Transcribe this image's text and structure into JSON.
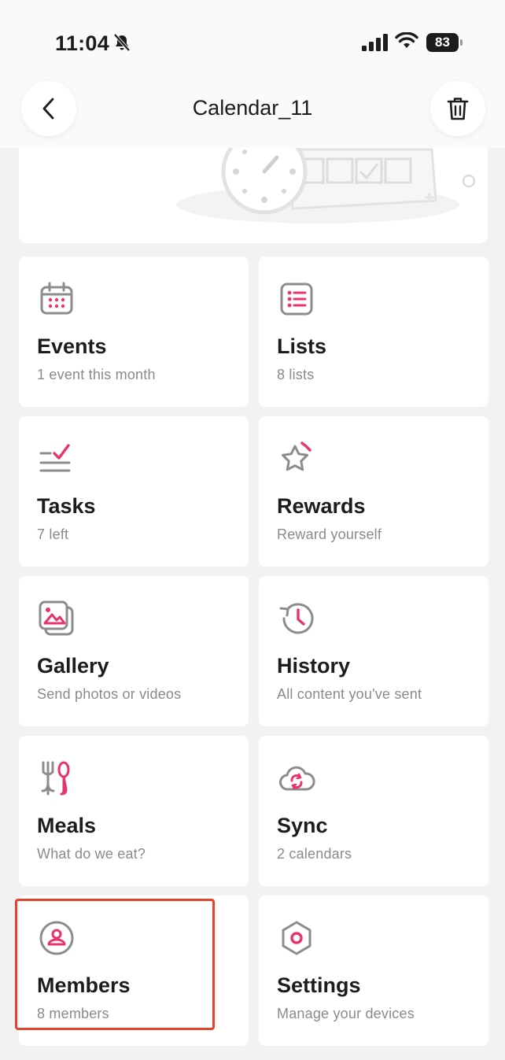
{
  "status": {
    "time": "11:04",
    "battery": "83"
  },
  "nav": {
    "title": "Calendar_11"
  },
  "colors": {
    "accent": "#e8336b",
    "icon_gray": "#8c8c90",
    "highlight": "#e4432d"
  },
  "tiles": [
    {
      "title": "Events",
      "subtitle": "1 event this month",
      "icon": "calendar-icon"
    },
    {
      "title": "Lists",
      "subtitle": "8 lists",
      "icon": "list-icon"
    },
    {
      "title": "Tasks",
      "subtitle": "7 left",
      "icon": "tasks-icon"
    },
    {
      "title": "Rewards",
      "subtitle": "Reward yourself",
      "icon": "star-icon"
    },
    {
      "title": "Gallery",
      "subtitle": "Send photos or videos",
      "icon": "gallery-icon"
    },
    {
      "title": "History",
      "subtitle": "All content you've sent",
      "icon": "history-icon"
    },
    {
      "title": "Meals",
      "subtitle": "What do we eat?",
      "icon": "meals-icon"
    },
    {
      "title": "Sync",
      "subtitle": "2 calendars",
      "icon": "cloud-sync-icon"
    },
    {
      "title": "Members",
      "subtitle": "8 members",
      "icon": "member-icon"
    },
    {
      "title": "Settings",
      "subtitle": "Manage your devices",
      "icon": "settings-icon"
    }
  ]
}
